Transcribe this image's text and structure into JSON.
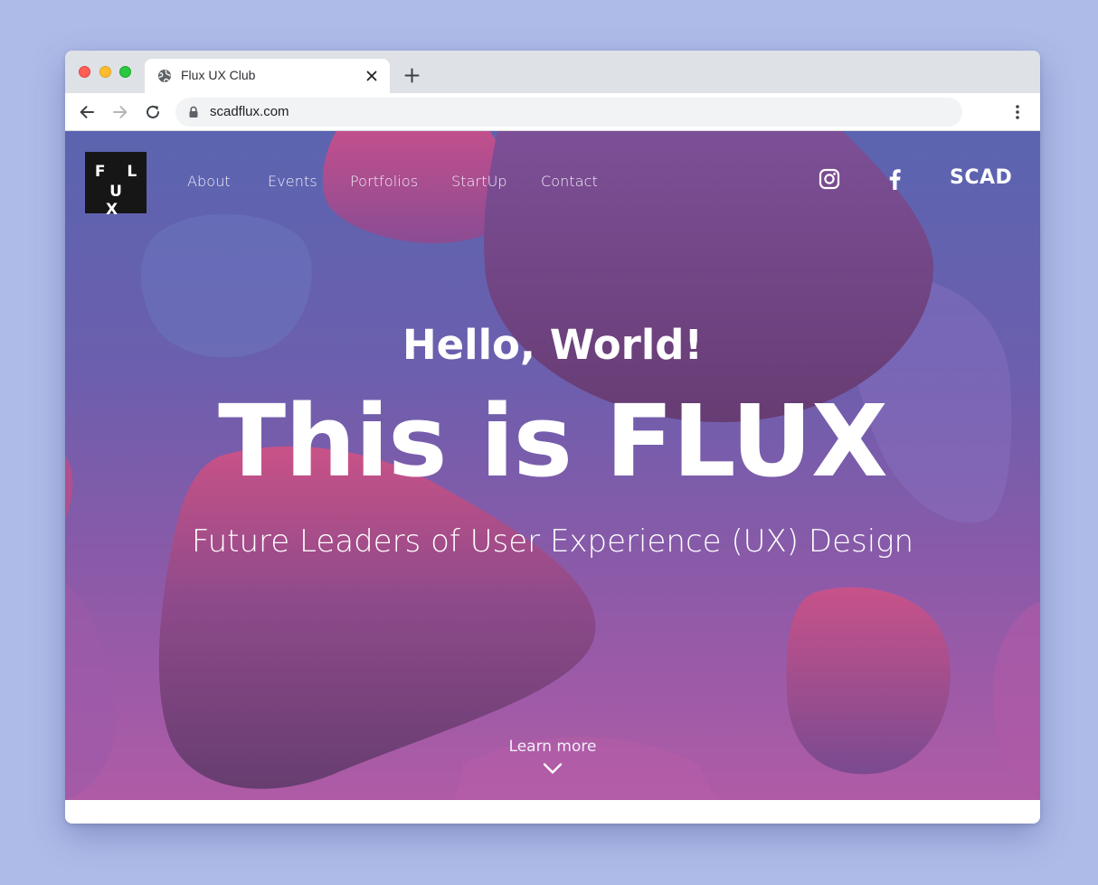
{
  "browser": {
    "tab_title": "Flux UX Club",
    "url": "scadflux.com",
    "icons": [
      "globe-icon",
      "close-icon",
      "plus-icon",
      "back-arrow-icon",
      "forward-arrow-icon",
      "reload-icon",
      "lock-icon",
      "more-vert-icon"
    ]
  },
  "site": {
    "logo_line1": "F L",
    "logo_line2": "U X",
    "nav": [
      "About",
      "Events",
      "Portfolios",
      "StartUp",
      "Contact"
    ],
    "social_icons": [
      "instagram-icon",
      "facebook-icon"
    ],
    "scad_label": "SCAD",
    "hero": {
      "greeting": "Hello, World!",
      "title": "This is FLUX",
      "subtitle": "Future Leaders of User Experience (UX) Design"
    },
    "learn_more": "Learn more",
    "colors": {
      "page_bg": "#aebbe8",
      "hero_blue": "#5b64b0",
      "hero_pink": "#c4508a",
      "hero_plum": "#6e3f78",
      "logo_bg": "#161616"
    }
  }
}
